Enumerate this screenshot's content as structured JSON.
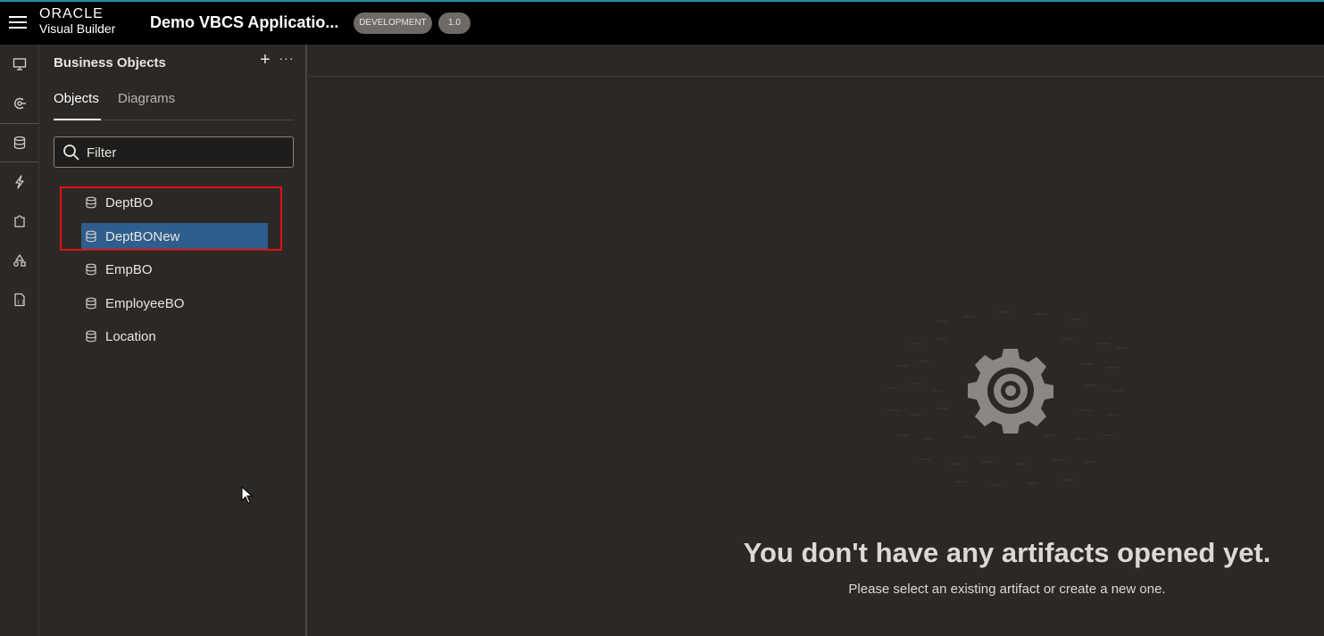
{
  "header": {
    "brand_top": "ORACLE",
    "brand_bottom": "Visual Builder",
    "app_title": "Demo VBCS Applicatio...",
    "env_badge": "DEVELOPMENT",
    "version_badge": "1.0"
  },
  "rail": {
    "items": [
      "desktop-icon",
      "service-connections-icon",
      "business-objects-icon",
      "events-icon",
      "components-icon",
      "layouts-icon",
      "source-icon"
    ],
    "active": "business-objects-icon"
  },
  "panel": {
    "title": "Business Objects",
    "tabs": [
      {
        "label": "Objects",
        "active": true
      },
      {
        "label": "Diagrams",
        "active": false
      }
    ],
    "filter_placeholder": "Filter",
    "objects": [
      {
        "label": "DeptBO",
        "selected": false
      },
      {
        "label": "DeptBONew",
        "selected": true
      },
      {
        "label": "EmpBO",
        "selected": false
      },
      {
        "label": "EmployeeBO",
        "selected": false
      },
      {
        "label": "Location",
        "selected": false
      }
    ]
  },
  "editor": {
    "empty_title": "You don't have any artifacts opened yet.",
    "empty_subtitle": "Please select an existing artifact or create a new one."
  },
  "colors": {
    "accent_top": "#1f8fa0",
    "selection": "#2f5d8c",
    "highlight": "#e01010"
  }
}
